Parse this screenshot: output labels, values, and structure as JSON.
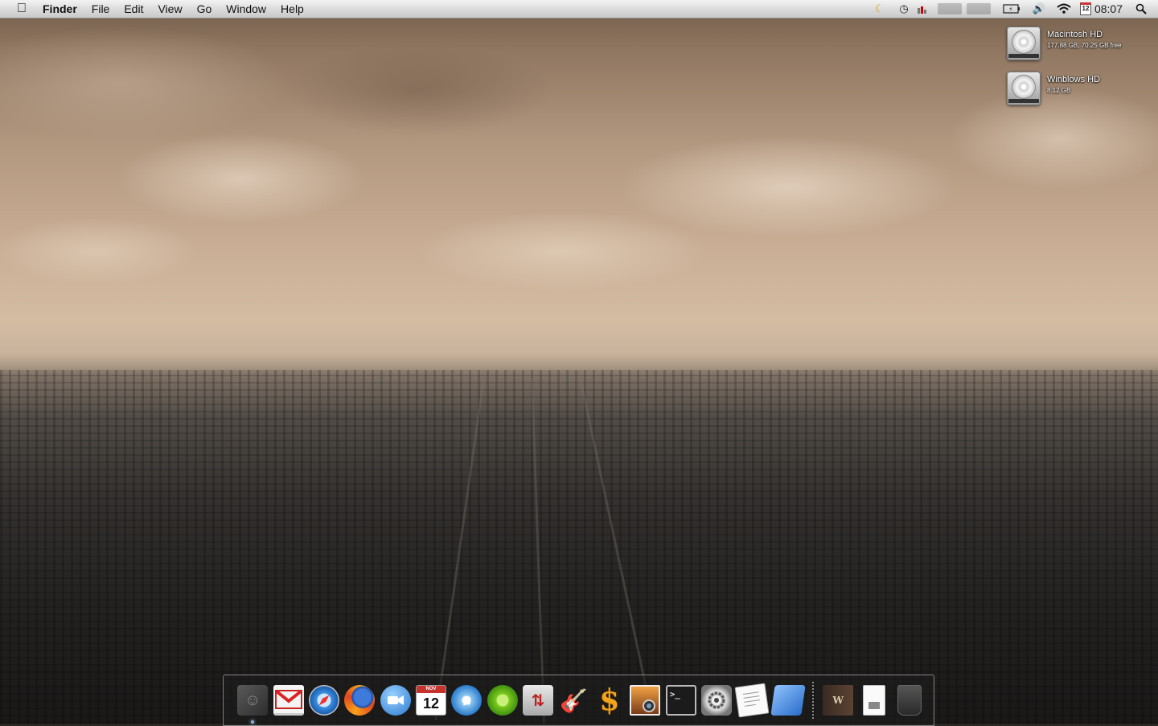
{
  "menubar": {
    "apple_icon": "apple-icon",
    "app_name": "Finder",
    "menus": [
      "File",
      "Edit",
      "View",
      "Go",
      "Window",
      "Help"
    ],
    "status_icons": [
      "moon-icon",
      "time-machine-icon",
      "cpu-meter-icon",
      "volume-icon",
      "battery-icon",
      "speaker-icon",
      "wifi-icon",
      "calendar-icon",
      "spotlight-icon"
    ],
    "calendar_date": "12",
    "clock": "08:07"
  },
  "desktop": {
    "drives": [
      {
        "name": "Macintosh HD",
        "info": "177.88 GB, 70.25 GB free",
        "icon": "hard-drive-icon"
      },
      {
        "name": "Winblows HD",
        "info": "8.12 GB",
        "icon": "hard-drive-icon"
      }
    ]
  },
  "dock": {
    "apps": [
      {
        "name": "Finder",
        "icon": "finder-icon",
        "running": true
      },
      {
        "name": "Gmail",
        "icon": "gmail-icon"
      },
      {
        "name": "Safari",
        "icon": "safari-icon"
      },
      {
        "name": "Firefox",
        "icon": "firefox-icon"
      },
      {
        "name": "iChat",
        "icon": "ichat-icon"
      },
      {
        "name": "iCal",
        "icon": "ical-icon",
        "month": "NOV",
        "day": "12"
      },
      {
        "name": "iTunes",
        "icon": "itunes-icon"
      },
      {
        "name": "LimeWire",
        "icon": "limewire-icon"
      },
      {
        "name": "Transmit",
        "icon": "transmit-icon"
      },
      {
        "name": "GarageBand",
        "icon": "garageband-icon"
      },
      {
        "name": "Cashculator",
        "icon": "cash-icon",
        "glyph": "$"
      },
      {
        "name": "iPhoto",
        "icon": "iphoto-icon"
      },
      {
        "name": "Terminal",
        "icon": "terminal-icon",
        "glyph": ">_"
      },
      {
        "name": "System Preferences",
        "icon": "system-preferences-icon"
      },
      {
        "name": "TextEdit",
        "icon": "textedit-icon"
      },
      {
        "name": "Microsoft Office",
        "icon": "office-icon"
      }
    ],
    "stack_items": [
      {
        "name": "Book",
        "icon": "book-icon",
        "glyph": "W"
      },
      {
        "name": "Documents",
        "icon": "document-icon"
      },
      {
        "name": "Trash",
        "icon": "trash-icon"
      }
    ]
  }
}
